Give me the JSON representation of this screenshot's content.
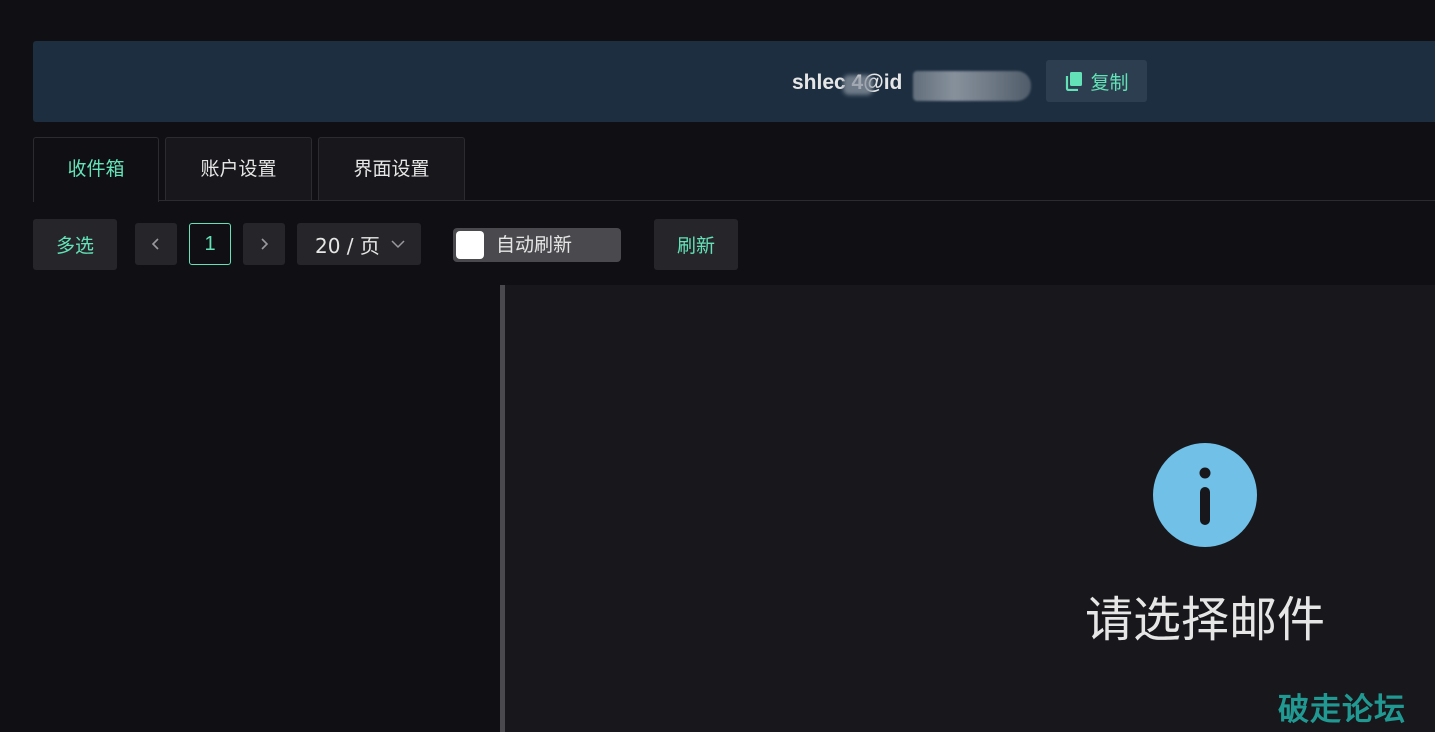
{
  "header": {
    "email_visible": "shlec  4@id",
    "copy_label": "复制"
  },
  "tabs": [
    {
      "label": "收件箱",
      "active": true
    },
    {
      "label": "账户设置",
      "active": false
    },
    {
      "label": "界面设置",
      "active": false
    }
  ],
  "toolbar": {
    "multi_select_label": "多选",
    "current_page": "1",
    "page_size_label": "20 / 页",
    "auto_refresh_label": "自动刷新",
    "auto_refresh_on": false,
    "refresh_label": "刷新"
  },
  "mail_view": {
    "empty_text": "请选择邮件"
  },
  "watermark": "破走论坛",
  "colors": {
    "accent": "#63e2b7",
    "header_bg": "#1c2e40",
    "info_icon": "#70c0e8",
    "watermark": "#23a8a0"
  },
  "icons": {
    "copy": "copy-icon",
    "prev": "chevron-left-icon",
    "next": "chevron-right-icon",
    "dropdown": "chevron-down-icon",
    "info": "info-icon"
  }
}
